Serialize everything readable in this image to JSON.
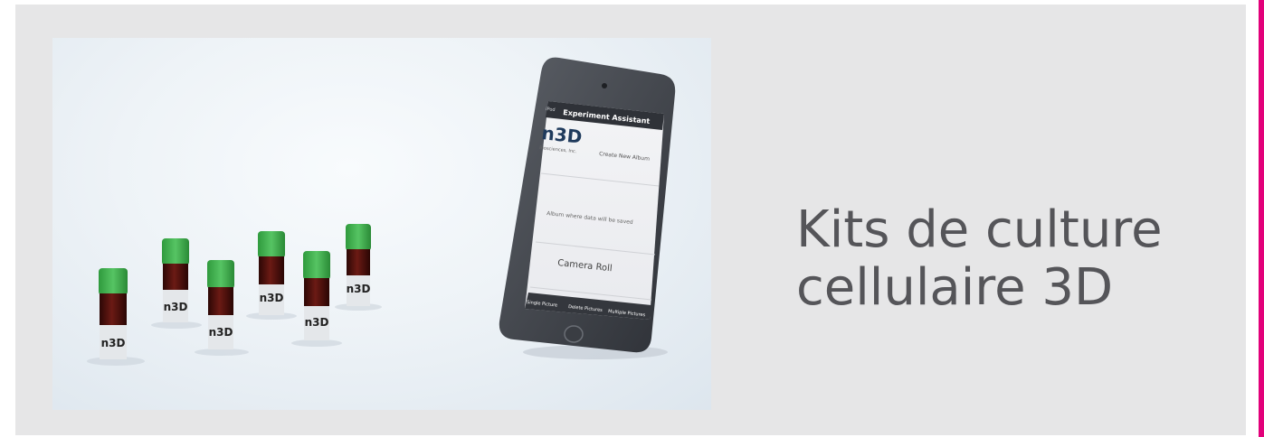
{
  "colors": {
    "card_background": "#e6e6e7",
    "accent": "#e2007a",
    "caption_text": "#555559",
    "vial_cap": "#3aa845",
    "vial_body": "#4a0f0c"
  },
  "caption": {
    "line1": "Kits de culture",
    "line2": "cellulaire 3D"
  },
  "photo": {
    "vial_label": "n3D",
    "phone": {
      "status_left": "iPod",
      "nav_title": "Experiment Assistant",
      "logo_text": "n3D",
      "logo_subtitle": "Biosciences, Inc.",
      "create_album": "Create New Album",
      "album_hint": "Album where data will be saved",
      "camera_roll": "Camera Roll",
      "tab_single": "Single Picture",
      "tab_delete": "Delete Pictures",
      "tab_multiple": "Multiple Pictures"
    }
  }
}
